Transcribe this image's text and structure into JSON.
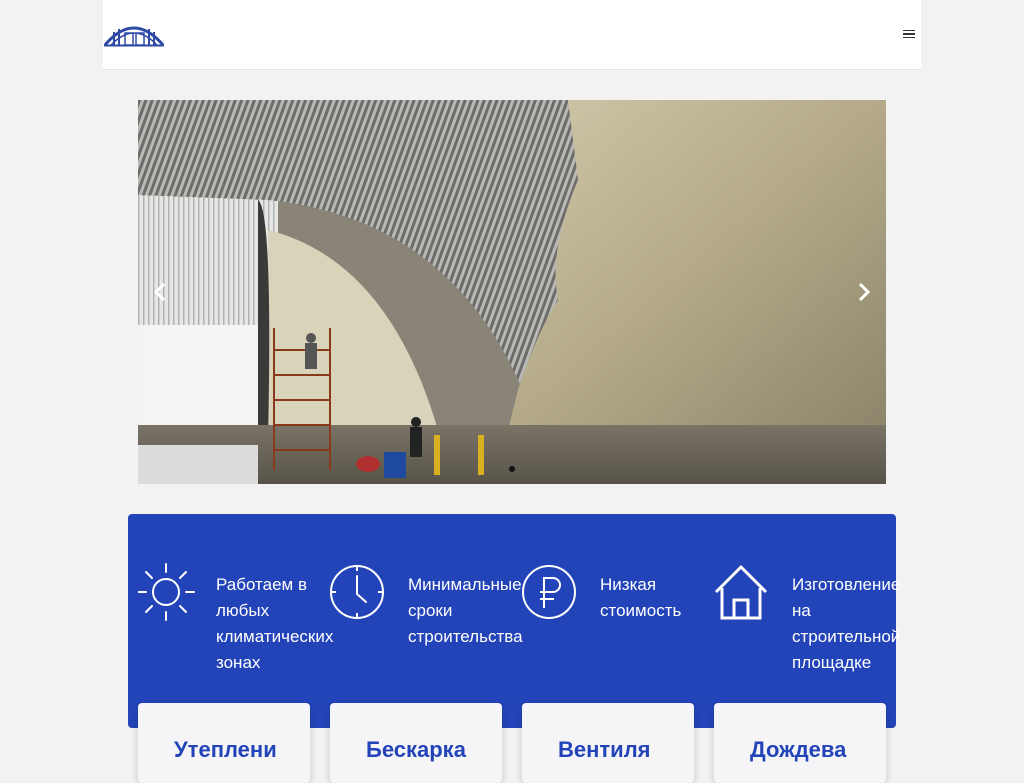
{
  "header": {
    "logo_icon": "hangar-arch-logo-icon",
    "menu_icon": "hamburger-menu-icon"
  },
  "slider": {
    "photo_description_icon": "slide-photo",
    "prev_icon": "chevron-left-icon",
    "next_icon": "chevron-right-icon",
    "active_slide": 1,
    "slide_count": 1
  },
  "features": {
    "background_color": "#2344b9",
    "items": [
      {
        "icon": "sun-icon",
        "text": "Работаем в\nлюбых\nклиматических\nзонах"
      },
      {
        "icon": "clock-icon",
        "text": "Минимальные\nсроки\nстроительства"
      },
      {
        "icon": "ruble-icon",
        "text": "Низкая\nстоимость"
      },
      {
        "icon": "house-icon",
        "text": "Изготовление\nна\nстроительной\nплощадке"
      }
    ]
  },
  "cards": [
    {
      "title": "Утеплени"
    },
    {
      "title": "Бескарка"
    },
    {
      "title": "Вентиля"
    },
    {
      "title": "Дождева"
    }
  ],
  "colors": {
    "accent": "#2344b9",
    "page_bg": "#f2f2f2"
  }
}
